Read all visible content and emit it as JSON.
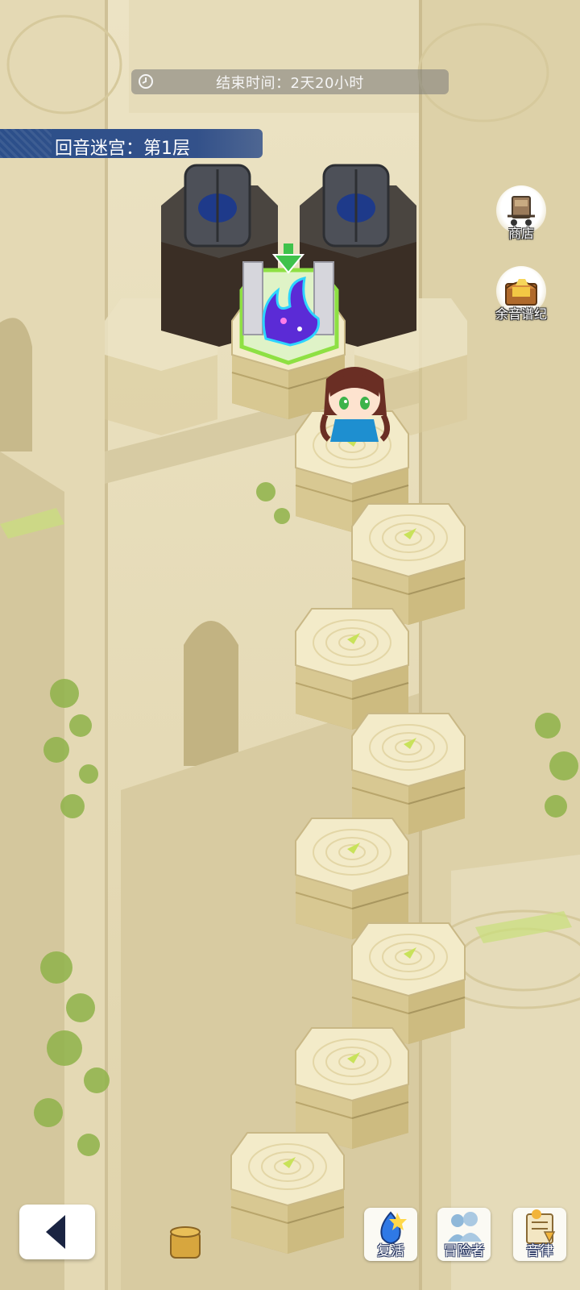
{
  "hud": {
    "timer_text": "结束时间：2天20小时",
    "floor_title": "回音迷宫：第1层"
  },
  "side_buttons": [
    {
      "label": "商店",
      "icon": "cart-icon"
    },
    {
      "label": "余音谱纪",
      "icon": "chest-icon"
    }
  ],
  "bottom_buttons": [
    {
      "label": "复活",
      "icon": "revive-icon"
    },
    {
      "label": "冒险者",
      "icon": "adventurers-icon"
    },
    {
      "label": "音律",
      "icon": "rhythm-icon"
    }
  ],
  "back_icon": "back-arrow-icon",
  "colors": {
    "banner": "#2c4f8a",
    "tile_top": "#f3ebc9",
    "tile_side": "#d7c690",
    "stone": "#e2d7b3",
    "portal": "#5b2bd6",
    "portal_glow": "#8ee043",
    "player_hair": "#6a2e24",
    "player_outfit": "#1e8fd0"
  }
}
